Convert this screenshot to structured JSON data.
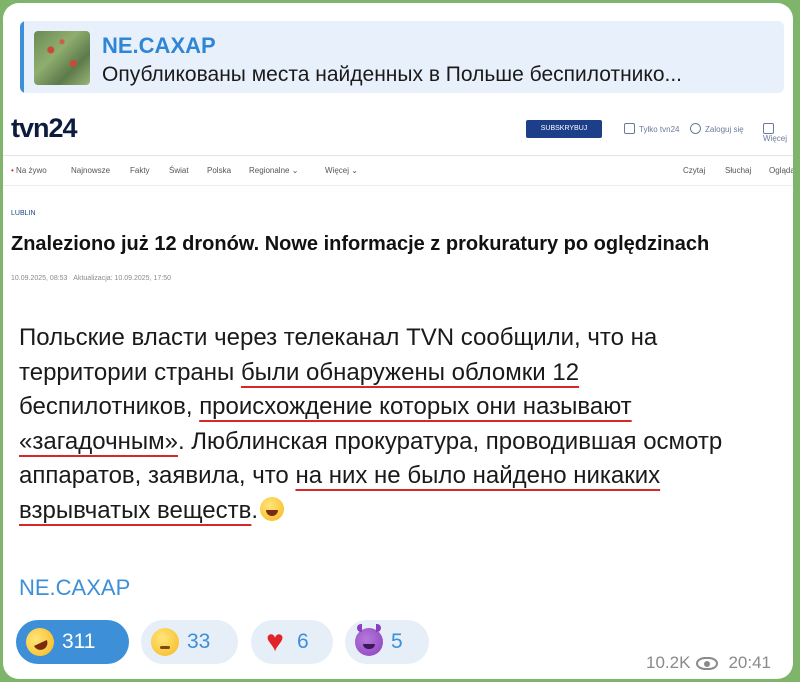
{
  "reply": {
    "title": "NE.CAXAP",
    "text": "Опубликованы места найденных в Польше беспилотнико..."
  },
  "embedded_page": {
    "logo": "tvn24",
    "subscribe_label": "SUBSKRYBUJ",
    "header_links": [
      "Tylko tvn24",
      "Zaloguj się",
      "Więcej"
    ],
    "nav_items": [
      "Na żywo",
      "Najnowsze",
      "Fakty",
      "Świat",
      "Polska",
      "Regionalne ⌄",
      "Więcej ⌄"
    ],
    "nav_right": [
      "Czytaj",
      "Słuchaj",
      "Oglądaj"
    ],
    "section": "LUBLIN",
    "headline": "Znaleziono już 12 dronów. Nowe informacje z prokuratury po oględzinach",
    "date": "10.09.2025, 08:53",
    "updated": "Aktualizacja: 10.09.2025, 17:50"
  },
  "post": {
    "p1": "Польские власти через телеканал TVN сообщили, что на территории страны ",
    "u1": "были обнаружены обломки 12",
    "p2": " беспилотников, ",
    "u2": "происхождение которых они называют «загадочным»",
    "p3": ". Люблинская прокуратура, проводившая осмотр аппаратов, заявила, что ",
    "u3": "на них не было найдено никаких взрывчатых веществ",
    "p4": ".",
    "signature": "NE.CAXAP"
  },
  "reactions": [
    {
      "icon": "rofl-emoji-icon",
      "count": "311",
      "active": true
    },
    {
      "icon": "thinking-emoji-icon",
      "count": "33",
      "active": false
    },
    {
      "icon": "heart-icon",
      "count": "6",
      "active": false
    },
    {
      "icon": "devil-emoji-icon",
      "count": "5",
      "active": false
    }
  ],
  "meta": {
    "views": "10.2K",
    "time": "20:41"
  },
  "colors": {
    "background": "#7fb56b",
    "accent": "#3d8fd8",
    "underline": "#d62828"
  }
}
